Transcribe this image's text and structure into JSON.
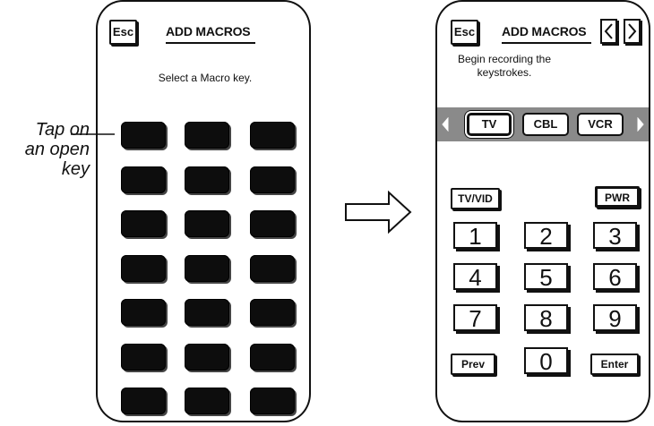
{
  "left_screen": {
    "esc_label": "Esc",
    "title": "ADD MACROS",
    "instruction": "Select a Macro key."
  },
  "annotation": {
    "line1": "Tap on",
    "line2": "an open",
    "line3": "key"
  },
  "right_screen": {
    "esc_label": "Esc",
    "title": "ADD MACROS",
    "instruction_line1": "Begin recording the",
    "instruction_line2": "keystrokes.",
    "devices": [
      "TV",
      "CBL",
      "VCR"
    ],
    "selected_device": "TV",
    "tvvid_label": "TV/VID",
    "pwr_label": "PWR",
    "digits": [
      "1",
      "2",
      "3",
      "4",
      "5",
      "6",
      "7",
      "8",
      "9",
      "0"
    ],
    "prev_label": "Prev",
    "enter_label": "Enter"
  },
  "icons": {
    "prev_page": "chevron-left-icon",
    "next_page": "chevron-right-icon",
    "device_scroll_left": "triangle-left-icon",
    "device_scroll_right": "triangle-right-icon",
    "flow": "outline-arrow-right-icon"
  }
}
